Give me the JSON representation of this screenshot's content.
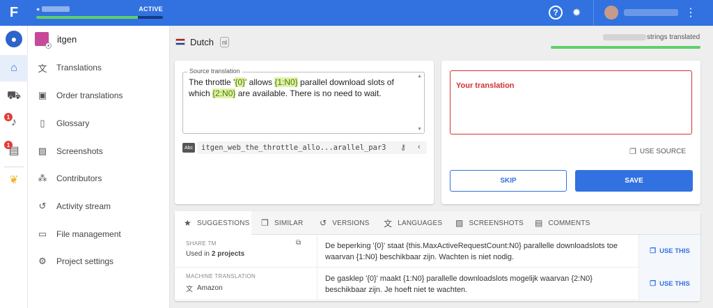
{
  "topbar": {
    "project_status": "ACTIVE",
    "progress": 0.8,
    "icons": [
      "help-icon",
      "bug-icon",
      "kebab-icon"
    ]
  },
  "rail": {
    "badges": {
      "notifications": "1",
      "messages": "1"
    }
  },
  "nav": {
    "project_name": "itgen",
    "items": [
      {
        "label": "Translations",
        "icon": "translate-icon"
      },
      {
        "label": "Order translations",
        "icon": "order-icon"
      },
      {
        "label": "Glossary",
        "icon": "glossary-icon"
      },
      {
        "label": "Screenshots",
        "icon": "image-icon"
      },
      {
        "label": "Contributors",
        "icon": "people-icon"
      },
      {
        "label": "Activity stream",
        "icon": "history-icon"
      },
      {
        "label": "File management",
        "icon": "file-icon"
      },
      {
        "label": "Project settings",
        "icon": "settings-icon"
      }
    ]
  },
  "language": {
    "name": "Dutch",
    "code": "nl",
    "strings_label": "strings translated"
  },
  "source": {
    "legend": "Source translation",
    "text_parts": [
      {
        "t": "The throttle '",
        "ph": false
      },
      {
        "t": "{0}",
        "ph": true
      },
      {
        "t": "' allows ",
        "ph": false
      },
      {
        "t": "{1:N0}",
        "ph": true
      },
      {
        "t": " parallel download slots of which ",
        "ph": false
      },
      {
        "t": "{2:N0}",
        "ph": true
      },
      {
        "t": " are available. There is no need to wait.",
        "ph": false
      }
    ],
    "key_badge": "Abc",
    "key": "itgen_web_the_throttle_allo...arallel_par3"
  },
  "translation": {
    "placeholder": "Your translation",
    "use_source": "USE SOURCE",
    "skip": "SKIP",
    "save": "SAVE"
  },
  "tabs": [
    {
      "label": "SUGGESTIONS",
      "icon": "star-icon"
    },
    {
      "label": "SIMILAR",
      "icon": "copy-icon"
    },
    {
      "label": "VERSIONS",
      "icon": "history-icon"
    },
    {
      "label": "LANGUAGES",
      "icon": "translate-icon"
    },
    {
      "label": "SCREENSHOTS",
      "icon": "image-icon"
    },
    {
      "label": "COMMENTS",
      "icon": "comment-icon"
    }
  ],
  "suggestions": [
    {
      "source_title": "SHARE TM",
      "source_sub_prefix": "Used in ",
      "source_sub_bold": "2 projects",
      "text": "De beperking '{0}' staat {this.MaxActiveRequestCount:N0} parallelle downloadslots toe waarvan {1:N0} beschikbaar zijn. Wachten is niet nodig.",
      "action": "USE THIS"
    },
    {
      "source_title": "MACHINE TRANSLATION",
      "source_sub": "Amazon",
      "text": "De gasklep '{0}' maakt {1:N0} parallelle downloadslots mogelijk waarvan {2:N0} beschikbaar zijn. Je hoeft niet te wachten.",
      "action": "USE THIS"
    }
  ]
}
